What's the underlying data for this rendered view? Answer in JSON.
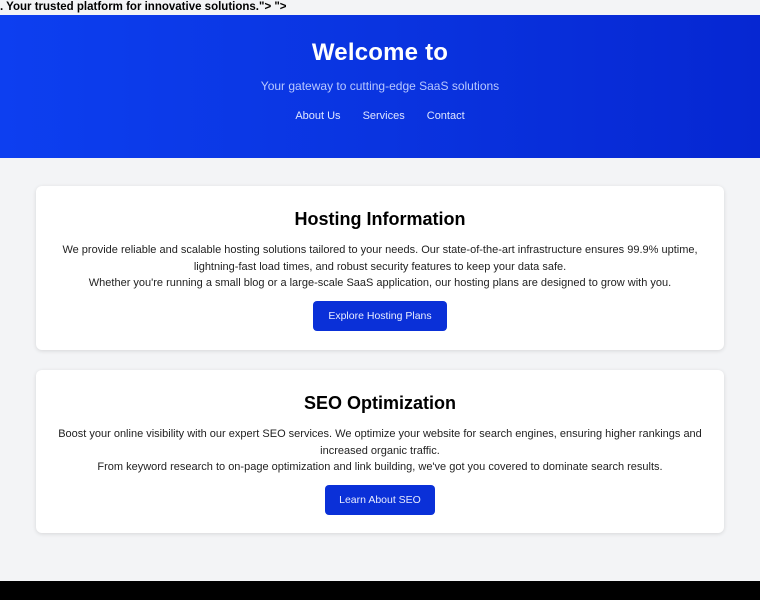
{
  "leaked_text": ". Your trusted platform for innovative solutions.\"> \">",
  "hero": {
    "title": "Welcome to",
    "tagline": "Your gateway to cutting-edge SaaS solutions",
    "nav": [
      "About Us",
      "Services",
      "Contact"
    ]
  },
  "hosting": {
    "title": "Hosting Information",
    "line1": "We provide reliable and scalable hosting solutions tailored to your needs. Our state-of-the-art infrastructure ensures 99.9% uptime, lightning-fast load times, and robust security features to keep your data safe.",
    "line2": "Whether you're running a small blog or a large-scale SaaS application, our hosting plans are designed to grow with you.",
    "button": "Explore Hosting Plans"
  },
  "seo": {
    "title": "SEO Optimization",
    "line1": "Boost your online visibility with our expert SEO services. We optimize your website for search engines, ensuring higher rankings and increased organic traffic.",
    "line2": "From keyword research to on-page optimization and link building, we've got you covered to dominate search results.",
    "button": "Learn About SEO"
  },
  "colors": {
    "brand": "#0a30d8",
    "page_bg": "#f3f4f6",
    "footer": "#000000"
  }
}
